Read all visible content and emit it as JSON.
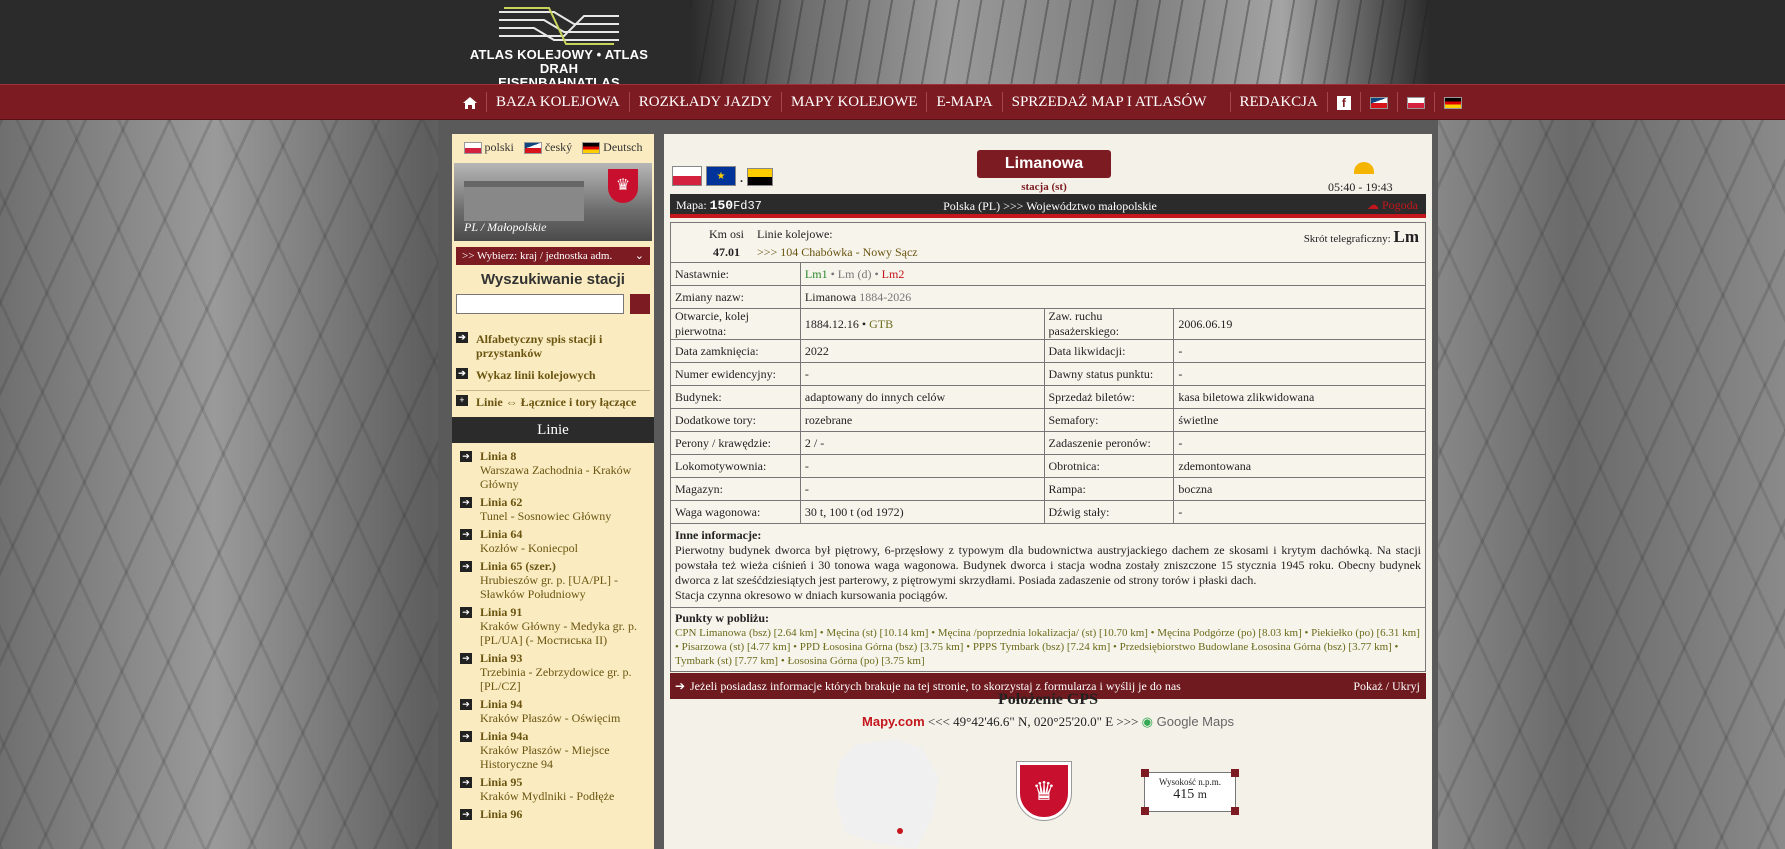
{
  "header": {
    "logo_line1": "ATLAS KOLEJOWY • ATLAS DRAH",
    "logo_line2": "EISENBAHNATLAS"
  },
  "nav": {
    "home_icon": "home-icon",
    "items": [
      "BAZA KOLEJOWA",
      "ROZKŁADY JAZDY",
      "MAPY KOLEJOWE",
      "E-MAPA",
      "SPRZEDAŻ MAP I ATLASÓW",
      "REDAKCJA"
    ],
    "facebook": "f"
  },
  "sidebar": {
    "langs": [
      "polski",
      "český",
      "Deutsch"
    ],
    "region_caption": "PL / Małopolskie",
    "select_label": ">> Wybierz: kraj / jednostka adm.",
    "search_title": "Wyszukiwanie stacji",
    "links": [
      "Alfabetyczny spis stacji i przystanków",
      "Wykaz linii kolejowych"
    ],
    "linie_link": "Linie ⇔ Łącznice i tory łączące",
    "linie_header": "Linie",
    "lines": [
      {
        "num": "Linia 8",
        "route": "Warszawa Zachodnia - Kraków Główny"
      },
      {
        "num": "Linia 62",
        "route": "Tunel - Sosnowiec Główny"
      },
      {
        "num": "Linia 64",
        "route": "Kozłów - Koniecpol"
      },
      {
        "num": "Linia 65 (szer.)",
        "route": "Hrubieszów gr. p. [UA/PL] - Sławków Południowy"
      },
      {
        "num": "Linia 91",
        "route": "Kraków Główny - Medyka gr. p. [PL/UA] (- Мостиська ІІ)"
      },
      {
        "num": "Linia 93",
        "route": "Trzebinia - Zebrzydowice gr. p. [PL/CZ]"
      },
      {
        "num": "Linia 94",
        "route": "Kraków Płaszów - Oświęcim"
      },
      {
        "num": "Linia 94a",
        "route": "Kraków Płaszów - Miejsce Historyczne 94"
      },
      {
        "num": "Linia 95",
        "route": "Kraków Mydlniki - Podłęże"
      },
      {
        "num": "Linia 96",
        "route": ""
      }
    ]
  },
  "station": {
    "name": "Limanowa",
    "type": "stacja (st)",
    "sun_time": "05:40 - 19:43",
    "map_label": "Mapa:",
    "map_code": "150",
    "map_sub": "Fd37",
    "location": "Polska (PL) >>> Województwo małopolskie",
    "weather": "Pogoda",
    "km_label": "Km osi",
    "km_value": "47.01",
    "lines_label": "Linie kolejowe:",
    "line": ">>> 104 Chabówka - Nowy Sącz",
    "tel_label": "Skrót telegraficzny:",
    "tel_code": "Lm"
  },
  "details": {
    "nastawnie_label": "Nastawnie:",
    "nastawnie": [
      "Lm1",
      "•",
      "Lm (d)",
      "•",
      "Lm2"
    ],
    "zmiany_label": "Zmiany nazw:",
    "zmiany_name": "Limanowa",
    "zmiany_years": "1884-2026",
    "otwarcie_label": "Otwarcie, kolej pierwotna:",
    "otwarcie_date": "1884.12.16 •",
    "otwarcie_kolej": "GTB",
    "rows": [
      {
        "l1": "Data zamknięcia:",
        "v1": "2022",
        "l2": "Data likwidacji:",
        "v2": "-"
      },
      {
        "l1": "Numer ewidencyjny:",
        "v1": "-",
        "l2": "Dawny status punktu:",
        "v2": "-"
      },
      {
        "l1": "Budynek:",
        "v1": "adaptowany do innych celów",
        "l2": "Sprzedaż biletów:",
        "v2": "kasa biletowa zlikwidowana"
      },
      {
        "l1": "Dodatkowe tory:",
        "v1": "rozebrane",
        "l2": "Semafory:",
        "v2": "świetlne"
      },
      {
        "l1": "Perony / krawędzie:",
        "v1": "2 / -",
        "l2": "Zadaszenie peronów:",
        "v2": "-"
      },
      {
        "l1": "Lokomotywownia:",
        "v1": "-",
        "l2": "Obrotnica:",
        "v2": "zdemontowana"
      },
      {
        "l1": "Magazyn:",
        "v1": "-",
        "l2": "Rampa:",
        "v2": "boczna"
      },
      {
        "l1": "Waga wagonowa:",
        "v1": "30 t, 100 t (od 1972)",
        "l2": "Dźwig stały:",
        "v2": "-"
      }
    ],
    "zaw_label": "Zaw. ruchu pasażerskiego:",
    "zaw_value": "2006.06.19",
    "more_title": "Inne informacje:",
    "more_text": "Pierwotny budynek dworca był piętrowy, 6-przęsłowy z typowym dla budownictwa austryjackiego dachem ze skosami i krytym dachówką. Na stacji powstała też wieża ciśnień i 30 tonowa waga wagonowa. Budynek dworca i stacja wodna zostały zniszczone 15 stycznia 1945 roku. Obecny budynek dworca z lat sześćdziesiątych jest parterowy, z piętrowymi skrzydłami. Posiada zadaszenie od strony torów i płaski dach.",
    "more_text2": "Stacja czynna okresowo w dniach kursowania pociągów.",
    "near_title": "Punkty w pobliżu:",
    "near_text": "CPN Limanowa (bsz) [2.64 km] • Męcina (st) [10.14 km] • Męcina /poprzednia lokalizacja/ (st) [10.70 km] • Męcina Podgórze (po) [8.03 km] • Piekiełko (po) [6.31 km] • Pisarzowa (st) [4.77 km] • PPD Łososina Górna (bsz) [3.75 km] • PPPS Tymbark (bsz) [7.24 km] • Przedsiębiorstwo Budowlane Łososina Górna (bsz) [3.77 km] • Tymbark (st) [7.77 km] • Łososina Górna (po) [3.75 km]",
    "msg": "Jeżeli posiadasz informacje których brakuje na tej stronie, to skorzystaj z formularza i wyślij je do nas",
    "msg_link": "Pokaż / Ukryj"
  },
  "gps": {
    "title": "Położenie GPS",
    "mapy": "Mapy.com",
    "coords": "<<< 49°42'46.6\" N, 020°25'20.0\" E >>>",
    "google": "Google Maps",
    "alt_label": "Wysokość n.p.m.",
    "alt_value": "415",
    "alt_unit": "m"
  }
}
